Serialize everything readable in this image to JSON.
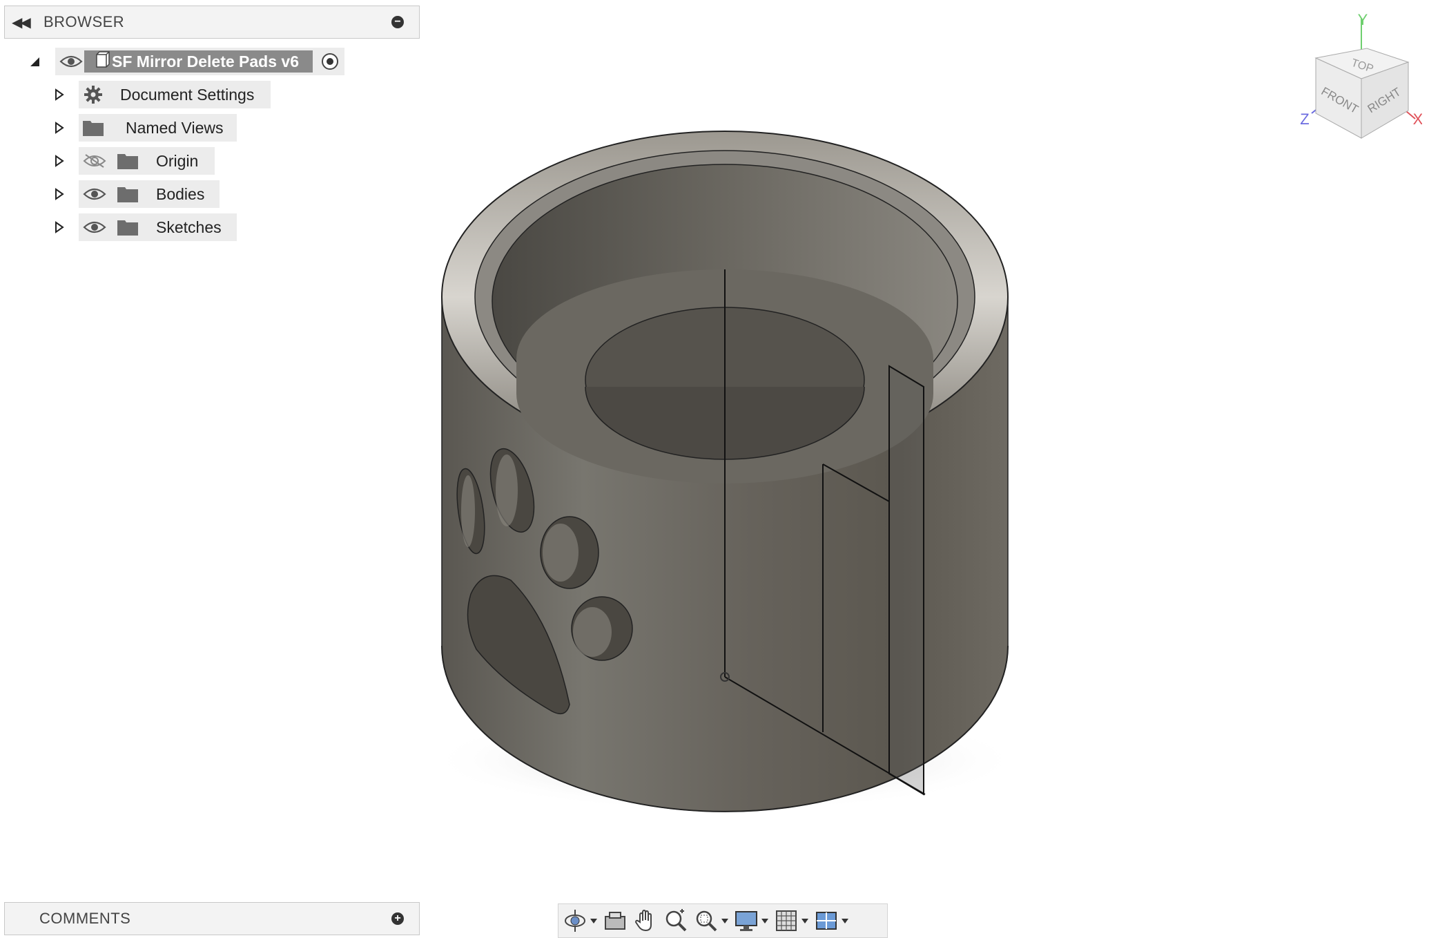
{
  "browser": {
    "title": "BROWSER",
    "root": {
      "label": "SF Mirror Delete Pads v6"
    },
    "items": [
      {
        "label": "Document Settings",
        "icon": "gear-icon"
      },
      {
        "label": "Named Views",
        "icon": "folder-icon"
      },
      {
        "label": "Origin",
        "icon": "folder-icon",
        "visibility": "hidden"
      },
      {
        "label": "Bodies",
        "icon": "folder-icon",
        "visibility": "visible"
      },
      {
        "label": "Sketches",
        "icon": "folder-icon",
        "visibility": "visible"
      }
    ]
  },
  "comments": {
    "title": "COMMENTS"
  },
  "viewcube": {
    "faces": {
      "top": "TOP",
      "front": "FRONT",
      "right": "RIGHT"
    },
    "axes": {
      "x": "X",
      "y": "Y",
      "z": "Z"
    },
    "colors": {
      "x": "#e0525a",
      "y": "#6fcf6f",
      "z": "#6b6be0"
    }
  },
  "toolbar": {
    "tools": [
      "orbit-icon",
      "look-at-icon",
      "pan-icon",
      "zoom-icon",
      "fit-icon",
      "display-settings-icon",
      "grid-icon",
      "viewports-icon"
    ]
  },
  "colors": {
    "model": "#6e6a63",
    "panel_bg": "#f3f3f3",
    "selection": "#8a8a8a"
  }
}
